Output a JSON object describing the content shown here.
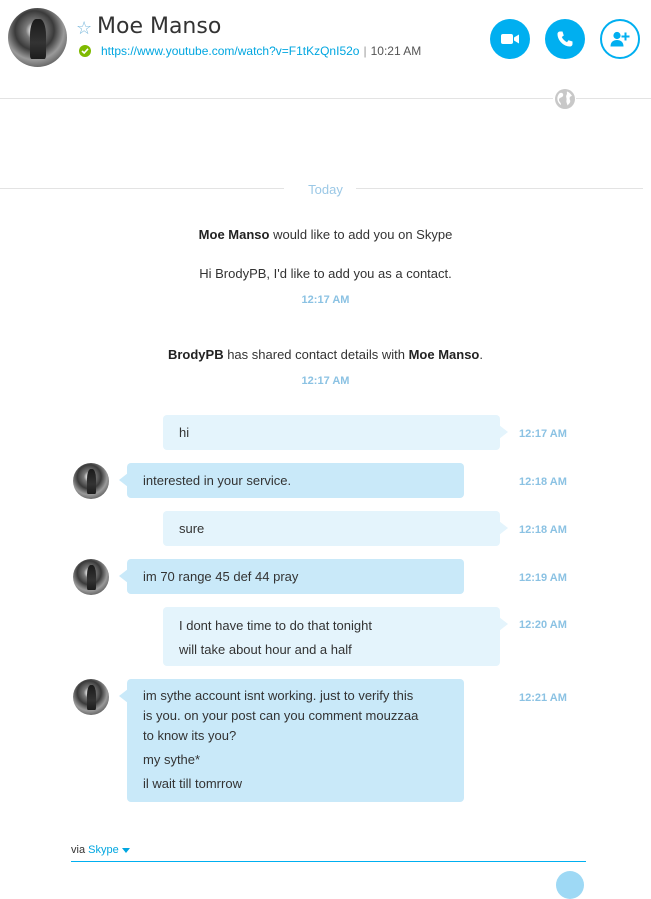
{
  "contact": {
    "name": "Moe Manso",
    "mood_link": "https://www.youtube.com/watch?v=F1tKzQnI52o",
    "mood_separator": "|",
    "local_time": "10:21 AM"
  },
  "header_actions": {
    "video_call": "video-camera-icon",
    "voice_call": "phone-icon",
    "add_people": "add-contact-icon"
  },
  "colors": {
    "accent": "#00aff0",
    "online": "#7fba00",
    "bubble_me": "#e4f4fc",
    "bubble_them": "#c9e9f9",
    "time": "#8bc2e3"
  },
  "divider_label": "Today",
  "system": {
    "request_name": "Moe Manso",
    "request_text": " would like to add you on Skype",
    "request_message": "Hi BrodyPB, I'd like to add you as a contact.",
    "request_time": "12:17 AM",
    "share_from": "BrodyPB",
    "share_text": " has shared contact details with ",
    "share_to": "Moe Manso",
    "share_end": ".",
    "share_time": "12:17 AM"
  },
  "messages": [
    {
      "sender": "me",
      "lines": [
        "hi"
      ],
      "time": "12:17 AM"
    },
    {
      "sender": "them",
      "lines": [
        "interested in your service."
      ],
      "time": "12:18 AM"
    },
    {
      "sender": "me",
      "lines": [
        "sure"
      ],
      "time": "12:18 AM"
    },
    {
      "sender": "them",
      "lines": [
        "im 70 range 45 def 44 pray"
      ],
      "time": "12:19 AM"
    },
    {
      "sender": "me",
      "lines": [
        "I dont have time to do that tonight",
        "will take about hour and a half"
      ],
      "time": "12:20 AM"
    },
    {
      "sender": "them",
      "lines": [
        "im sythe account isnt working. just to verify this",
        "is you. on your post can you comment mouzzaa",
        "to know its you?",
        "my sythe*",
        "il wait till tomrrow"
      ],
      "time": "12:21 AM"
    }
  ],
  "compose": {
    "via_label": "via",
    "service": "Skype"
  }
}
